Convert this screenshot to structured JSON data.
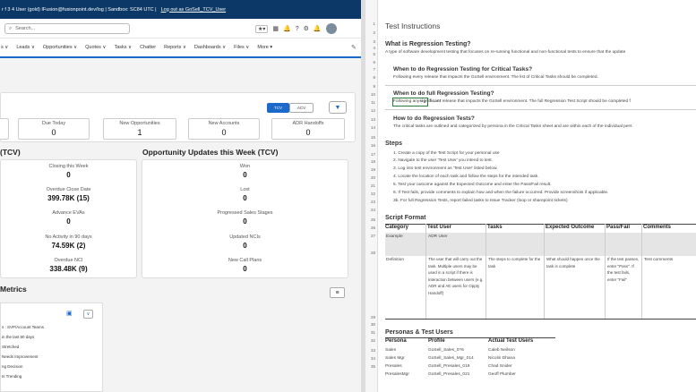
{
  "topbar": {
    "text": "r f 3 4 User (gold) IFusion@fusionpoint.dev/log | Sandbox: SC84 UTC |",
    "link": "Log out as GoSell_TCV_User"
  },
  "search": {
    "placeholder": "Search..."
  },
  "header_icons": {
    "fav": "★▾",
    "waffle": "▦",
    "bell": "🔔",
    "help": "?",
    "gear": "⚙",
    "notif": "🔔"
  },
  "nav": {
    "items": [
      "s ∨",
      "Leads ∨",
      "Opportunities ∨",
      "Quotes ∨",
      "Tasks ∨",
      "Chatter",
      "Reports ∨",
      "Dashboards ∨",
      "Files ∨",
      "More ▾"
    ],
    "pencil": "✎"
  },
  "toggles": {
    "tcv": "TCV",
    "acv": "ACV",
    "filter": "▼"
  },
  "metrics": [
    {
      "label": "",
      "value": ""
    },
    {
      "label": "Due Today",
      "value": "0"
    },
    {
      "label": "New Opportunities",
      "value": "1"
    },
    {
      "label": "New Accounts",
      "value": "0"
    },
    {
      "label": "ADR Handoffs",
      "value": "0"
    }
  ],
  "section_left": "(TCV)",
  "section_right": "Opportunity Updates this Week (TCV)",
  "left_stats": [
    {
      "label": "Closing this Week",
      "value": "0"
    },
    {
      "label": "Overdue Close Date",
      "value": "399.78K (15)"
    },
    {
      "label": "Advance EVAs",
      "value": "0"
    },
    {
      "label": "No Activity in 90 days",
      "value": "74.59K (2)"
    },
    {
      "label": "Overdue NCI",
      "value": "338.48K (9)"
    }
  ],
  "right_stats": [
    {
      "label": "Won",
      "value": "0"
    },
    {
      "label": "Lost",
      "value": "0"
    },
    {
      "label": "Progressed Sales Stages",
      "value": "0"
    },
    {
      "label": "Updated NCIs",
      "value": "0"
    },
    {
      "label": "New Call Plans",
      "value": "0"
    }
  ],
  "metrics_title": "Metrics",
  "metrics_menu": "≡",
  "metrics_panel": {
    "icon": "▣",
    "chevron": "∨",
    "rows": [
      "s : SVP/Account Teams",
      "in the last 90 days",
      "Stretched",
      "Needs Improvement",
      "ng Decision",
      "ts Trending"
    ]
  },
  "sheet": {
    "rownums": [
      "1",
      "2",
      "3",
      "4",
      "5",
      "6",
      "7",
      "8",
      "9",
      "10",
      "11",
      "12",
      "13",
      "14",
      "15",
      "16",
      "17",
      "18",
      "19",
      "20",
      "21",
      "22",
      "23",
      "24",
      "25",
      "26",
      "27",
      "28",
      "29",
      "30",
      "31",
      "32",
      "33",
      "34",
      "35"
    ],
    "title": "Test Instructions",
    "what_h": "What is Regression Testing?",
    "what_t": "A type of software development testing that focuses on re-running functional and non-functional tests to ensure that the update",
    "crit_h": "When to do Regression Testing for Critical Tasks?",
    "crit_t": "Following every release that impacts the GoSell environment. The list of Critical Tasks should be completed.",
    "full_h": "When to do full Regression Testing?",
    "full_t1": "Following any",
    "full_t2": "significant",
    "full_t3": "release that impacts the GoSell environment. The full Regression Test Script should be completed f",
    "how_h": "How to do Regression Tests?",
    "how_t": "The critical tasks are outlined and categorized by persona in the Critical Tasks sheet and are within each of the individual pers",
    "steps_h": "Steps",
    "steps": [
      "1. Create a copy of the Test Script for your personal use",
      "2. Navigate to the user 'Test User' you intend to test.",
      "3. Log into test environment as 'Test User' listed below.",
      "4. Locate the location of each task and follow the steps for the intended task.",
      "5. Test your outcome against the Expected Outcome and enter the Pass/Fail result.",
      "6. If Test fails, provide comments to explain how and when the failure occurred. Provide screenshots if applicable.",
      "3b. For full Regression Tests, report failed tasks to Issue Tracker (loop or sharepoint tickets)"
    ],
    "format_h": "Script Format",
    "format_cols": [
      "Category",
      "Test User",
      "Tasks",
      "Expected Outcome",
      "Pass/Fail",
      "Comments"
    ],
    "example_row": [
      "Example",
      "ADR User"
    ],
    "def_row": {
      "category": "Definition",
      "test_user": "The user that will carry out the task. Multiple users may be used in a script if there is interaction between users (e.g. ADR and AE users for Oppty Handoff)",
      "tasks": "The steps to complete for the task",
      "expected": "What should happen once the task is complete",
      "passfail": "If the test passes, enter \"Pass\". If the test fails, enter \"Fail\"",
      "comments": "Test comments"
    },
    "personas_h": "Personas & Test Users",
    "personas_cols": [
      "Persona",
      "Profile",
      "Actual Test Users"
    ],
    "personas": [
      [
        "Sales",
        "GoSell_Sales_0?6",
        "Caleb Neilson"
      ],
      [
        "Sales Mgr",
        "GoSell_Sales_Mgr_014",
        "Nicolin Dhana"
      ],
      [
        "Presales",
        "GoSell_Presales_019",
        "Chad Snider"
      ],
      [
        "PresalesMgr",
        "GoSell_Presales_021",
        "Geoff Plumber"
      ]
    ]
  }
}
